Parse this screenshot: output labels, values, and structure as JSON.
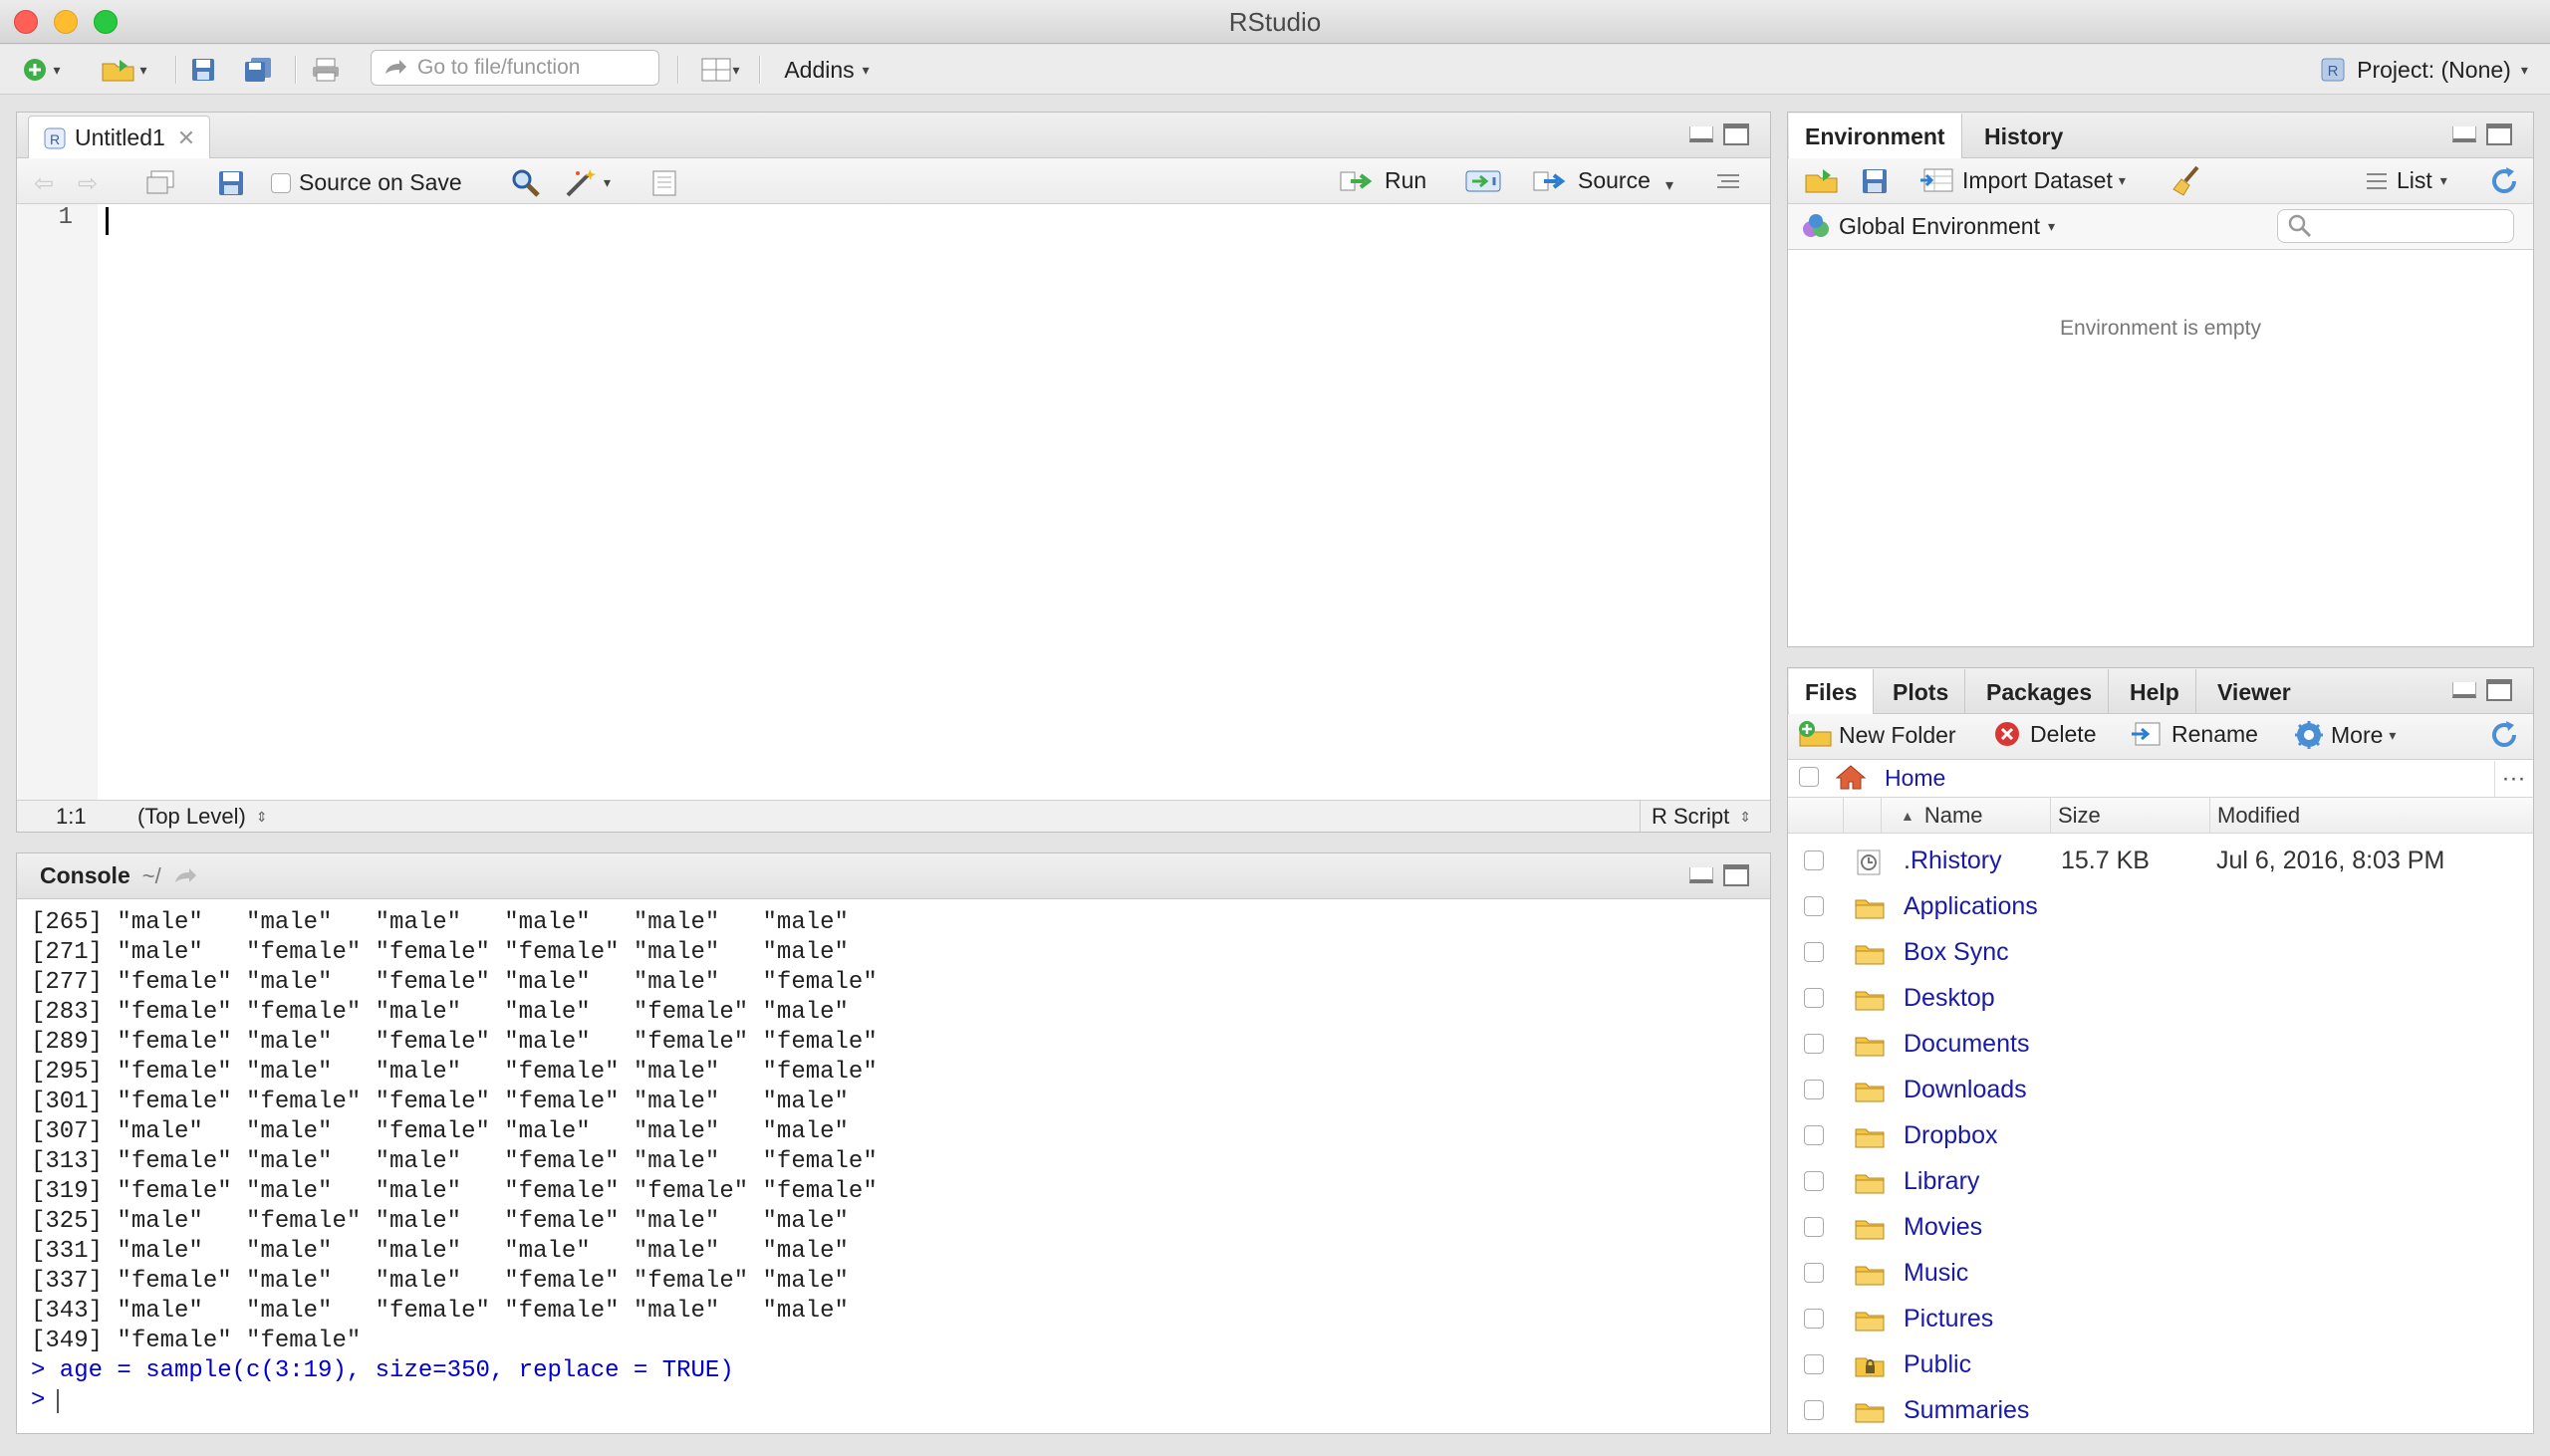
{
  "window": {
    "title": "RStudio"
  },
  "toolbar": {
    "goto_placeholder": "Go to file/function",
    "addins": "Addins",
    "project": "Project: (None)"
  },
  "editor": {
    "tab_label": "Untitled1",
    "source_on_save": "Source on Save",
    "run": "Run",
    "source": "Source",
    "line_number": "1",
    "cursor_pos": "1:1",
    "scope": "(Top Level)",
    "file_type": "R Script"
  },
  "console": {
    "title": "Console",
    "path": "~/",
    "lines": [
      "[265] \"male\"   \"male\"   \"male\"   \"male\"   \"male\"   \"male\"",
      "[271] \"male\"   \"female\" \"female\" \"female\" \"male\"   \"male\"",
      "[277] \"female\" \"male\"   \"female\" \"male\"   \"male\"   \"female\"",
      "[283] \"female\" \"female\" \"male\"   \"male\"   \"female\" \"male\"",
      "[289] \"female\" \"male\"   \"female\" \"male\"   \"female\" \"female\"",
      "[295] \"female\" \"male\"   \"male\"   \"female\" \"male\"   \"female\"",
      "[301] \"female\" \"female\" \"female\" \"female\" \"male\"   \"male\"",
      "[307] \"male\"   \"male\"   \"female\" \"male\"   \"male\"   \"male\"",
      "[313] \"female\" \"male\"   \"male\"   \"female\" \"male\"   \"female\"",
      "[319] \"female\" \"male\"   \"male\"   \"female\" \"female\" \"female\"",
      "[325] \"male\"   \"female\" \"male\"   \"female\" \"male\"   \"male\"",
      "[331] \"male\"   \"male\"   \"male\"   \"male\"   \"male\"   \"male\"",
      "[337] \"female\" \"male\"   \"male\"   \"female\" \"female\" \"male\"",
      "[343] \"male\"   \"male\"   \"female\" \"female\" \"male\"   \"male\"",
      "[349] \"female\" \"female\""
    ],
    "command": "> age = sample(c(3:19), size=350, replace = TRUE)",
    "prompt": ">"
  },
  "environment": {
    "tabs": [
      "Environment",
      "History"
    ],
    "import_dataset": "Import Dataset",
    "list": "List",
    "global_env": "Global Environment",
    "empty_message": "Environment is empty"
  },
  "files": {
    "tabs": [
      "Files",
      "Plots",
      "Packages",
      "Help",
      "Viewer"
    ],
    "new_folder": "New Folder",
    "delete": "Delete",
    "rename": "Rename",
    "more": "More",
    "breadcrumb": "Home",
    "columns": {
      "name": "Name",
      "size": "Size",
      "modified": "Modified"
    },
    "items": [
      {
        "name": ".Rhistory",
        "size": "15.7 KB",
        "modified": "Jul 6, 2016, 8:03 PM",
        "icon": "history-file-icon"
      },
      {
        "name": "Applications",
        "size": "",
        "modified": "",
        "icon": "folder-icon"
      },
      {
        "name": "Box Sync",
        "size": "",
        "modified": "",
        "icon": "folder-icon"
      },
      {
        "name": "Desktop",
        "size": "",
        "modified": "",
        "icon": "folder-icon"
      },
      {
        "name": "Documents",
        "size": "",
        "modified": "",
        "icon": "folder-icon"
      },
      {
        "name": "Downloads",
        "size": "",
        "modified": "",
        "icon": "folder-icon"
      },
      {
        "name": "Dropbox",
        "size": "",
        "modified": "",
        "icon": "folder-icon"
      },
      {
        "name": "Library",
        "size": "",
        "modified": "",
        "icon": "folder-icon"
      },
      {
        "name": "Movies",
        "size": "",
        "modified": "",
        "icon": "folder-icon"
      },
      {
        "name": "Music",
        "size": "",
        "modified": "",
        "icon": "folder-icon"
      },
      {
        "name": "Pictures",
        "size": "",
        "modified": "",
        "icon": "folder-icon"
      },
      {
        "name": "Public",
        "size": "",
        "modified": "",
        "icon": "locked-folder-icon"
      },
      {
        "name": "Summaries",
        "size": "",
        "modified": "",
        "icon": "folder-icon"
      }
    ]
  },
  "colors": {
    "link": "#1a1aa8",
    "command": "#0000cc",
    "close_red": "#fe5f57",
    "minimize_yellow": "#febc2e",
    "zoom_green": "#28c840"
  }
}
